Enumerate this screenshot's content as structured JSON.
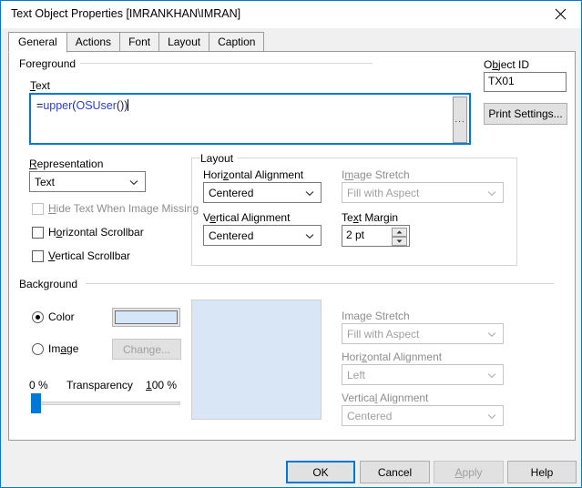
{
  "window": {
    "title": "Text Object Properties [IMRANKHAN\\IMRAN]",
    "close_icon": "close-icon",
    "accent_color": "#0078d7",
    "dialog_bg": "#f0f0f0",
    "page_bg": "#ffffff"
  },
  "tabs": [
    {
      "label": "General",
      "active": true
    },
    {
      "label": "Actions",
      "active": false
    },
    {
      "label": "Font",
      "active": false
    },
    {
      "label": "Layout",
      "active": false
    },
    {
      "label": "Caption",
      "active": false
    }
  ],
  "foreground": {
    "group_label": "Foreground",
    "text_label": "Text",
    "text_value": "=upper(OSUser())",
    "text_parts": {
      "equals": "=",
      "function": "upper",
      "open_paren": "(",
      "inner": "OSUser",
      "inner_parens": "()",
      "close_paren": ")"
    },
    "browse_button_label": "...",
    "colors": {
      "equals": "#1a1a4a",
      "function": "#2b3fd0",
      "paren": "#1a1a4a"
    }
  },
  "object_id": {
    "label": "Object ID",
    "value": "TX01",
    "print_settings_label": "Print Settings..."
  },
  "representation": {
    "label": "Representation",
    "value": "Text",
    "options": [
      "Text"
    ],
    "checkboxes": [
      {
        "label": "Hide Text When Image Missing",
        "checked": false,
        "disabled": true
      },
      {
        "label": "Horizontal Scrollbar",
        "checked": false,
        "disabled": false
      },
      {
        "label": "Vertical Scrollbar",
        "checked": false,
        "disabled": false
      }
    ]
  },
  "layout_group": {
    "group_label": "Layout",
    "horizontal_alignment": {
      "label": "Horizontal Alignment",
      "value": "Centered",
      "disabled": false
    },
    "vertical_alignment": {
      "label": "Vertical Alignment",
      "value": "Centered",
      "disabled": false
    },
    "image_stretch": {
      "label": "Image Stretch",
      "value": "Fill with Aspect",
      "disabled": true
    },
    "text_margin": {
      "label": "Text Margin",
      "value": "2 pt"
    }
  },
  "background": {
    "group_label": "Background",
    "color_radio_label": "Color",
    "image_radio_label": "Image",
    "selected": "Color",
    "swatch_color": "#d4e6f7",
    "change_button_label": "Change...",
    "transparency": {
      "min_label": "0 %",
      "label": "Transparency",
      "max_label": "100 %",
      "value": 0
    },
    "preview_color": "#d9e6f5",
    "image_stretch": {
      "label": "Image Stretch",
      "value": "Fill with Aspect",
      "disabled": true
    },
    "horizontal_alignment": {
      "label": "Horizontal Alignment",
      "value": "Left",
      "disabled": true
    },
    "vertical_alignment": {
      "label": "Vertical Alignment",
      "value": "Centered",
      "disabled": true
    }
  },
  "footer": {
    "ok_label": "OK",
    "cancel_label": "Cancel",
    "apply_label": "Apply",
    "help_label": "Help",
    "apply_disabled": true,
    "ok_default": true
  }
}
